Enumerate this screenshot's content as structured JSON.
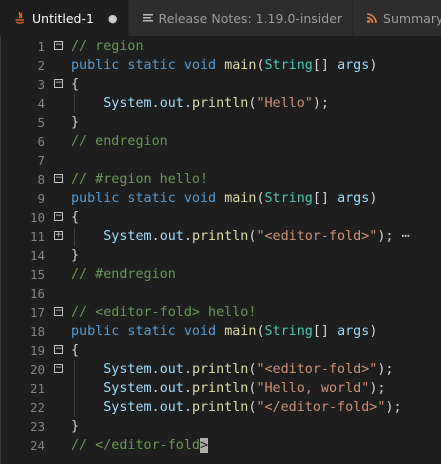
{
  "tabs": [
    {
      "label": "Untitled-1",
      "icon": "java-icon",
      "dirty": true,
      "active": true
    },
    {
      "label": "Release Notes: 1.19.0-insider",
      "icon": "document-lines-icon",
      "active": false
    },
    {
      "label": "Summary.x",
      "icon": "rss-icon",
      "active": false
    }
  ],
  "dirty_marker": "●",
  "colors": {
    "keyword": "#569cd6",
    "comment": "#6a9955",
    "type": "#4ec9b0",
    "function": "#dcdcaa",
    "variable": "#9cdcfe",
    "string": "#ce9178",
    "punct": "#d4d4d4"
  },
  "lines": [
    {
      "n": "1",
      "fold": "−",
      "tokens": [
        [
          "comment",
          "// region"
        ]
      ]
    },
    {
      "n": "2",
      "tokens": [
        [
          "keyword",
          "public static void "
        ],
        [
          "function",
          "main"
        ],
        [
          "punct",
          "("
        ],
        [
          "type",
          "String"
        ],
        [
          "punct",
          "[] "
        ],
        [
          "variable",
          "args"
        ],
        [
          "punct",
          ")"
        ]
      ]
    },
    {
      "n": "3",
      "fold": "−",
      "tokens": [
        [
          "punct",
          "{"
        ]
      ]
    },
    {
      "n": "4",
      "tokens": [
        [
          "punct",
          "    "
        ],
        [
          "variable",
          "System"
        ],
        [
          "punct",
          "."
        ],
        [
          "variable",
          "out"
        ],
        [
          "punct",
          "."
        ],
        [
          "function",
          "println"
        ],
        [
          "punct",
          "("
        ],
        [
          "string",
          "\"Hello\""
        ],
        [
          "punct",
          ");"
        ]
      ]
    },
    {
      "n": "5",
      "tokens": [
        [
          "punct",
          "}"
        ]
      ]
    },
    {
      "n": "6",
      "tokens": [
        [
          "comment",
          "// endregion"
        ]
      ]
    },
    {
      "n": "7",
      "tokens": []
    },
    {
      "n": "8",
      "fold": "−",
      "tokens": [
        [
          "comment",
          "// #region hello!"
        ]
      ]
    },
    {
      "n": "9",
      "tokens": [
        [
          "keyword",
          "public static void "
        ],
        [
          "function",
          "main"
        ],
        [
          "punct",
          "("
        ],
        [
          "type",
          "String"
        ],
        [
          "punct",
          "[] "
        ],
        [
          "variable",
          "args"
        ],
        [
          "punct",
          ")"
        ]
      ]
    },
    {
      "n": "10",
      "fold": "−",
      "tokens": [
        [
          "punct",
          "{"
        ]
      ]
    },
    {
      "n": "11",
      "fold": "+",
      "tokens": [
        [
          "punct",
          "    "
        ],
        [
          "variable",
          "System"
        ],
        [
          "punct",
          "."
        ],
        [
          "variable",
          "out"
        ],
        [
          "punct",
          "."
        ],
        [
          "function",
          "println"
        ],
        [
          "punct",
          "("
        ],
        [
          "string",
          "\"<editor-fold>\""
        ],
        [
          "punct",
          ");"
        ],
        [
          "ellipsis",
          " ⋯"
        ]
      ]
    },
    {
      "n": "14",
      "tokens": [
        [
          "punct",
          "}"
        ]
      ]
    },
    {
      "n": "15",
      "tokens": [
        [
          "comment",
          "// #endregion"
        ]
      ]
    },
    {
      "n": "16",
      "tokens": []
    },
    {
      "n": "17",
      "fold": "−",
      "tokens": [
        [
          "comment",
          "// <editor-fold> hello!"
        ]
      ]
    },
    {
      "n": "18",
      "tokens": [
        [
          "keyword",
          "public static void "
        ],
        [
          "function",
          "main"
        ],
        [
          "punct",
          "("
        ],
        [
          "type",
          "String"
        ],
        [
          "punct",
          "[] "
        ],
        [
          "variable",
          "args"
        ],
        [
          "punct",
          ")"
        ]
      ]
    },
    {
      "n": "19",
      "fold": "−",
      "tokens": [
        [
          "punct",
          "{"
        ]
      ]
    },
    {
      "n": "20",
      "fold": "−",
      "tokens": [
        [
          "punct",
          "    "
        ],
        [
          "variable",
          "System"
        ],
        [
          "punct",
          "."
        ],
        [
          "variable",
          "out"
        ],
        [
          "punct",
          "."
        ],
        [
          "function",
          "println"
        ],
        [
          "punct",
          "("
        ],
        [
          "string",
          "\"<editor-fold>\""
        ],
        [
          "punct",
          ");"
        ]
      ]
    },
    {
      "n": "21",
      "tokens": [
        [
          "punct",
          "    "
        ],
        [
          "variable",
          "System"
        ],
        [
          "punct",
          "."
        ],
        [
          "variable",
          "out"
        ],
        [
          "punct",
          "."
        ],
        [
          "function",
          "println"
        ],
        [
          "punct",
          "("
        ],
        [
          "string",
          "\"Hello, world\""
        ],
        [
          "punct",
          ");"
        ]
      ]
    },
    {
      "n": "22",
      "tokens": [
        [
          "punct",
          "    "
        ],
        [
          "variable",
          "System"
        ],
        [
          "punct",
          "."
        ],
        [
          "variable",
          "out"
        ],
        [
          "punct",
          "."
        ],
        [
          "function",
          "println"
        ],
        [
          "punct",
          "("
        ],
        [
          "string",
          "\"</editor-fold>\""
        ],
        [
          "punct",
          ");"
        ]
      ]
    },
    {
      "n": "23",
      "tokens": [
        [
          "punct",
          "}"
        ]
      ]
    },
    {
      "n": "24",
      "tokens": [
        [
          "comment",
          "// </editor-fold"
        ],
        [
          "cursor",
          ">"
        ]
      ]
    }
  ]
}
